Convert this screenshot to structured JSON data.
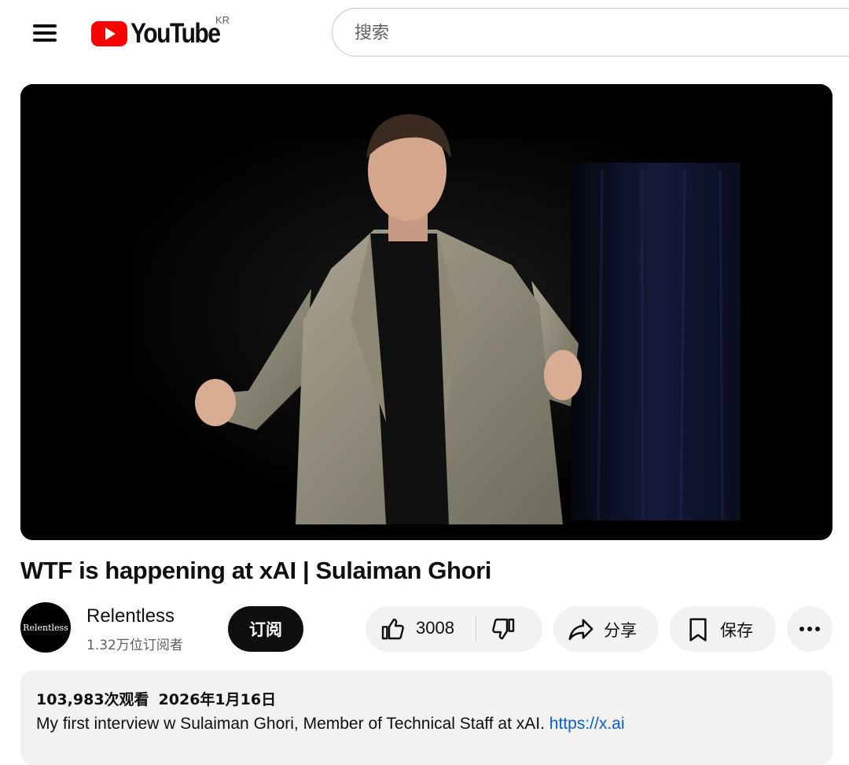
{
  "header": {
    "logo_text": "YouTube",
    "country_code": "KR",
    "search_placeholder": "搜索",
    "brand_color": "#ff0000"
  },
  "icons": {
    "menu": "hamburger-menu-icon",
    "play": "youtube-play-icon",
    "like": "thumbs-up-icon",
    "dislike": "thumbs-down-icon",
    "share": "share-arrow-icon",
    "save": "bookmark-icon",
    "more": "more-horizontal-icon"
  },
  "video": {
    "title": "WTF is happening at xAI | Sulaiman Ghori"
  },
  "channel": {
    "avatar_text": "Relentless",
    "name": "Relentless",
    "subscribers": "1.32万位订阅者",
    "subscribe_label": "订阅"
  },
  "actions": {
    "like_count": "3008",
    "share_label": "分享",
    "save_label": "保存"
  },
  "description": {
    "views": "103,983次观看",
    "date": "2026年1月16日",
    "text": "My first interview w Sulaiman Ghori, Member of Technical Staff at xAI. ",
    "link": "https://x.ai",
    "link_color": "#065fd4"
  }
}
